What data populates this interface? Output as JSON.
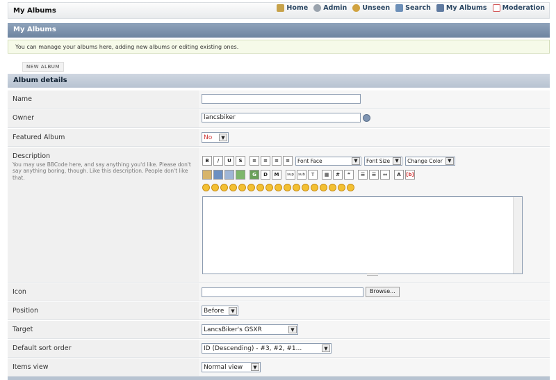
{
  "header": {
    "title": "My Albums",
    "nav": [
      {
        "label": "Home",
        "icon": "home-icon",
        "color": "#c7a24a"
      },
      {
        "label": "Admin",
        "icon": "admin-icon",
        "color": "#9aa3ad"
      },
      {
        "label": "Unseen",
        "icon": "unseen-icon",
        "color": "#d1a340"
      },
      {
        "label": "Search",
        "icon": "search-icon",
        "color": "#6c8fb8"
      },
      {
        "label": "My Albums",
        "icon": "albums-icon",
        "color": "#5f7aa0"
      },
      {
        "label": "Moderation",
        "icon": "moderation-icon",
        "color": "#d35a5a"
      }
    ]
  },
  "banner": {
    "title": "My Albums"
  },
  "info": {
    "text": "You can manage your albums here, adding new albums or editing existing ones."
  },
  "new_album_button": "NEW ALBUM",
  "section": {
    "title": "Album details"
  },
  "form": {
    "name": {
      "label": "Name",
      "value": ""
    },
    "owner": {
      "label": "Owner",
      "value": "lancsbiker"
    },
    "featured": {
      "label": "Featured Album",
      "value": "No"
    },
    "description": {
      "label": "Description",
      "help": "You may use BBCode here, and say anything you'd like. Please don't say anything boring, though. Like this description. People don't like that.",
      "toolbar": {
        "font_face": "Font Face",
        "font_size": "Font Size",
        "change_color": "Change Color",
        "sup": "sup",
        "sub": "sub"
      }
    },
    "icon": {
      "label": "Icon",
      "browse": "Browse..."
    },
    "position": {
      "label": "Position",
      "value": "Before"
    },
    "target": {
      "label": "Target",
      "value": "LancsBiker's GSXR"
    },
    "sort": {
      "label": "Default sort order",
      "value": "ID (Descending) - #3, #2, #1..."
    },
    "view": {
      "label": "Items view",
      "value": "Normal view"
    }
  },
  "colors": {
    "banner": "#7b90aa",
    "section_header": "#c3ccd8",
    "info_bg": "#f6fae9"
  }
}
